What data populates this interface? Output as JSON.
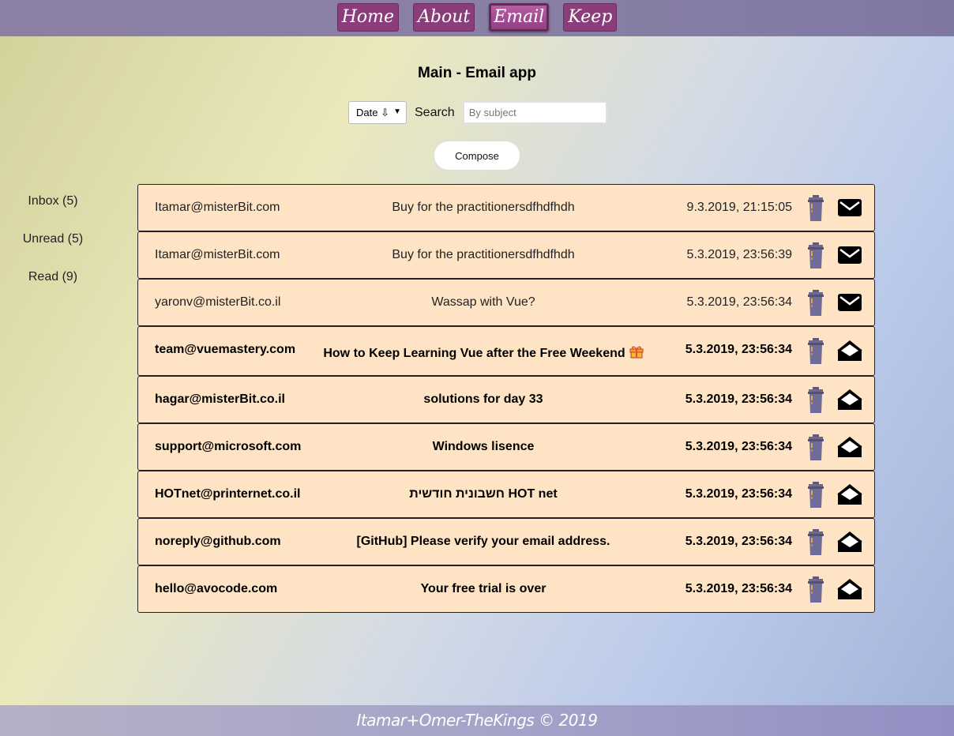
{
  "nav": {
    "items": [
      {
        "label": "Home",
        "active": false
      },
      {
        "label": "About",
        "active": false
      },
      {
        "label": "Email",
        "active": true
      },
      {
        "label": "Keep",
        "active": false
      }
    ]
  },
  "page": {
    "title": "Main - Email app"
  },
  "controls": {
    "sort_value": "Date ⇩",
    "search_label": "Search",
    "search_placeholder": "By subject",
    "compose_label": "Compose"
  },
  "sidebar": {
    "items": [
      {
        "label": "Inbox (5)"
      },
      {
        "label": "Unread (5)"
      },
      {
        "label": "Read (9)"
      }
    ]
  },
  "emails": [
    {
      "from": "Itamar@misterBit.com",
      "subject": "Buy for the practitionersdfhdfhdh",
      "date": "9.3.2019, 21:15:05",
      "read": true
    },
    {
      "from": "Itamar@misterBit.com",
      "subject": "Buy for the practitionersdfhdfhdh",
      "date": "5.3.2019, 23:56:39",
      "read": true
    },
    {
      "from": "yaronv@misterBit.co.il",
      "subject": "Wassap with Vue?",
      "date": "5.3.2019, 23:56:34",
      "read": true
    },
    {
      "from": "team@vuemastery.com",
      "subject": "How to Keep Learning Vue after the Free Weekend",
      "date": "5.3.2019, 23:56:34",
      "read": false,
      "gift": true
    },
    {
      "from": "hagar@misterBit.co.il",
      "subject": "solutions for day 33",
      "date": "5.3.2019, 23:56:34",
      "read": false
    },
    {
      "from": "support@microsoft.com",
      "subject": "Windows lisence",
      "date": "5.3.2019, 23:56:34",
      "read": false
    },
    {
      "from": "HOTnet@printernet.co.il",
      "subject": "חשבונית חודשית HOT net",
      "date": "5.3.2019, 23:56:34",
      "read": false
    },
    {
      "from": "noreply@github.com",
      "subject": "[GitHub] Please verify your email address.",
      "date": "5.3.2019, 23:56:34",
      "read": false
    },
    {
      "from": "hello@avocode.com",
      "subject": "Your free trial is over",
      "date": "5.3.2019, 23:56:34",
      "read": false
    }
  ],
  "footer": {
    "text": "Itamar+Omer-TheKings © 2019"
  },
  "icons": {
    "trash": "trash-icon",
    "closed_envelope": "envelope-closed-icon",
    "open_envelope": "envelope-open-icon",
    "gift": "gift-icon"
  },
  "colors": {
    "nav_button": "#8a3d7a",
    "row_background": "#fee4c4"
  }
}
